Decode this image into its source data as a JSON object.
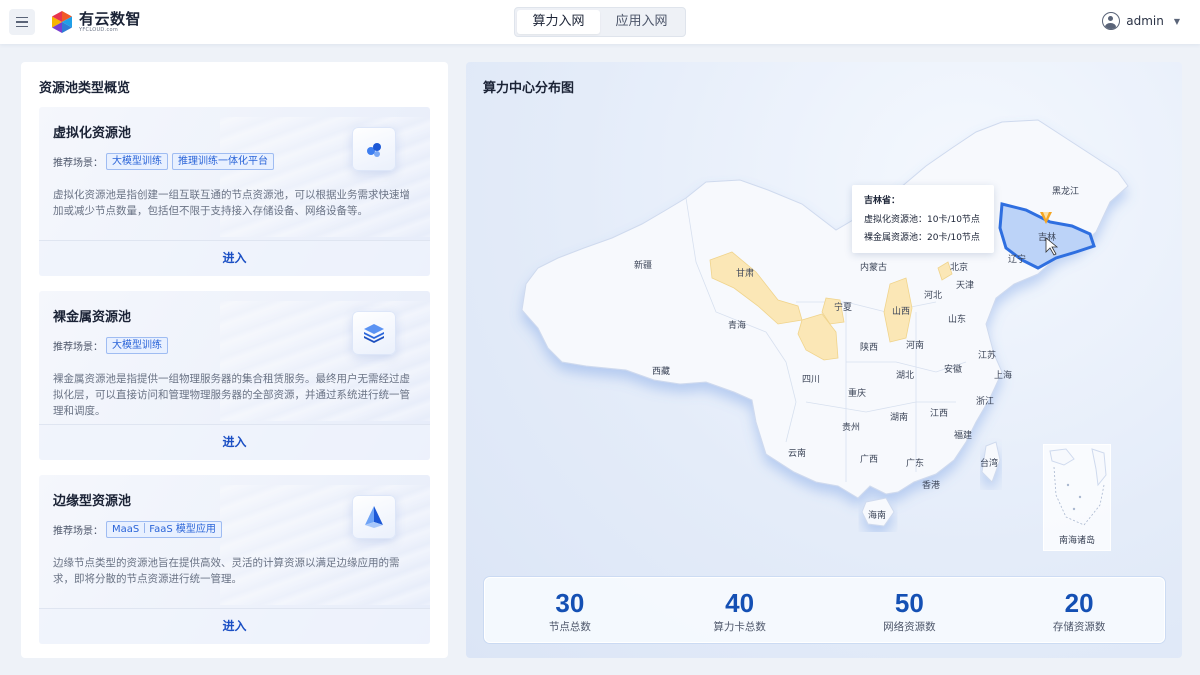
{
  "header": {
    "logo_name": "有云数智",
    "logo_sub": "YFCLOUD.com",
    "tabs": [
      {
        "label": "算力入网",
        "active": true
      },
      {
        "label": "应用入网",
        "active": false
      }
    ],
    "user": "admin"
  },
  "left_panel": {
    "title": "资源池类型概览",
    "scene_label": "推荐场景：",
    "enter_label": "进入",
    "pools": [
      {
        "name": "虚拟化资源池",
        "tags": [
          "大模型训练",
          "推理训练一体化平台"
        ],
        "desc": "虚拟化资源池是指创建一组互联互通的节点资源池，可以根据业务需求快速增加或减少节点数量，包括但不限于支持接入存储设备、网络设备等。",
        "icon": "cube-cluster-icon"
      },
      {
        "name": "裸金属资源池",
        "tags": [
          "大模型训练"
        ],
        "desc": "裸金属资源池是指提供一组物理服务器的集合租赁服务。最终用户无需经过虚拟化层，可以直接访问和管理物理服务器的全部资源，并通过系统进行统一管理和调度。",
        "icon": "server-stack-icon"
      },
      {
        "name": "边缘型资源池",
        "tags": [
          "MaaS｜FaaS 模型应用"
        ],
        "desc": "边缘节点类型的资源池旨在提供高效、灵活的计算资源以满足边缘应用的需求，即将分散的节点资源进行统一管理。",
        "icon": "pyramid-icon"
      }
    ]
  },
  "map_panel": {
    "title": "算力中心分布图",
    "highlight_color": "#2f6fe0",
    "resource_color": "#fbe7b6",
    "tooltip": {
      "title": "吉林省：",
      "rows": [
        "虚拟化资源池：10卡/10节点",
        "裸金属资源池：20卡/10节点"
      ]
    },
    "provinces": {
      "heilongjiang": "黑龙江",
      "jilin": "吉林",
      "liaoning": "辽宁",
      "neimenggu": "内蒙古",
      "beijing": "北京",
      "tianjin": "天津",
      "hebei": "河北",
      "shanxi": "山西",
      "shandong": "山东",
      "xinjiang": "新疆",
      "gansu": "甘肃",
      "qinghai": "青海",
      "ningxia": "宁夏",
      "shaanxi": "陕西",
      "henan": "河南",
      "jiangsu": "江苏",
      "shanghai": "上海",
      "anhui": "安徽",
      "hubei": "湖北",
      "sichuan": "四川",
      "xizang": "西藏",
      "chongqing": "重庆",
      "zhejiang": "浙江",
      "hunan": "湖南",
      "jiangxi": "江西",
      "guizhou": "贵州",
      "fujian": "福建",
      "yunnan": "云南",
      "guangxi": "广西",
      "guangdong": "广东",
      "taiwan": "台湾",
      "hongkong": "香港",
      "hainan": "海南"
    },
    "inset_label": "南海诸岛",
    "stats": [
      {
        "value": "30",
        "label": "节点总数"
      },
      {
        "value": "40",
        "label": "算力卡总数"
      },
      {
        "value": "50",
        "label": "网络资源数"
      },
      {
        "value": "20",
        "label": "存储资源数"
      }
    ]
  }
}
